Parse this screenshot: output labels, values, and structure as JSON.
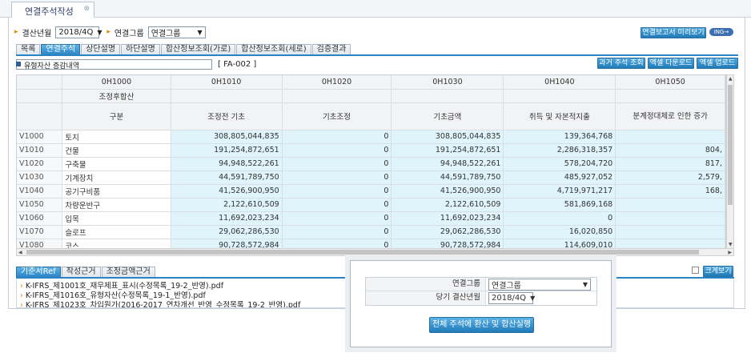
{
  "window_tab": {
    "title": "연결주석작성",
    "close": "⊗"
  },
  "filters": {
    "period_label": "결산년월",
    "period_value": "2018/4Q",
    "group_label": "연결그룹",
    "group_value": "연결그룹"
  },
  "buttons": {
    "preview": "연결보고서 미리보기",
    "ing": "ING→"
  },
  "subtabs": [
    "목록",
    "연결주석",
    "상단설명",
    "하단설명",
    "합산정보조회(가로)",
    "합산정보조회(세로)",
    "검증결과"
  ],
  "account": {
    "name": "유형자산 증감내역",
    "code": "[ FA-002 ]"
  },
  "actions": {
    "past": "과거 주석 조회",
    "download": "엑셀 다운로드",
    "upload": "엑셀 업로드"
  },
  "grid": {
    "col_codes": [
      "0H1000",
      "0H1010",
      "0H1020",
      "0H1030",
      "0H1040",
      "0H1050"
    ],
    "group_label": "조정후합산",
    "kind_label": "구분",
    "col_names": [
      "조정전 기초",
      "기초조정",
      "기초금액",
      "취득 및 자본적지출",
      "분계정대체로 인한 증가"
    ],
    "rows": [
      {
        "code": "V1000",
        "name": "토지",
        "v": [
          "308,805,044,835",
          "0",
          "308,805,044,835",
          "139,364,768",
          ""
        ]
      },
      {
        "code": "V1010",
        "name": "건물",
        "v": [
          "191,254,872,651",
          "0",
          "191,254,872,651",
          "2,286,318,357",
          "804,"
        ]
      },
      {
        "code": "V1020",
        "name": "구축물",
        "v": [
          "94,948,522,261",
          "0",
          "94,948,522,261",
          "578,204,720",
          "817,"
        ]
      },
      {
        "code": "V1030",
        "name": "기계장치",
        "v": [
          "44,591,789,750",
          "0",
          "44,591,789,750",
          "485,927,052",
          "2,579,"
        ]
      },
      {
        "code": "V1040",
        "name": "공기구비품",
        "v": [
          "41,526,900,950",
          "0",
          "41,526,900,950",
          "4,719,971,217",
          "168,"
        ]
      },
      {
        "code": "V1050",
        "name": "차량운반구",
        "v": [
          "2,122,610,509",
          "0",
          "2,122,610,509",
          "581,869,168",
          ""
        ]
      },
      {
        "code": "V1060",
        "name": "입목",
        "v": [
          "11,692,023,234",
          "0",
          "11,692,023,234",
          "0",
          ""
        ]
      },
      {
        "code": "V1070",
        "name": "슬로프",
        "v": [
          "29,062,286,530",
          "0",
          "29,062,286,530",
          "16,020,850",
          ""
        ]
      },
      {
        "code": "V1080",
        "name": "코스",
        "v": [
          "90,728,572,984",
          "0",
          "90,728,572,984",
          "114,609,010",
          ""
        ]
      }
    ]
  },
  "bottom_tabs": [
    "기준서Ref",
    "작성근거",
    "조정금액근거"
  ],
  "bottom_btn": "크게보기",
  "files": [
    "K-IFRS_제1001호_재무제표_표시(수정목록_19-2_반영).pdf",
    "K-IFRS_제1016호_유형자산(수정목록_19-1_반영).pdf",
    "K-IFRS_제1023호_차입원가(2016-2017_연차개선_반영_수정목록_19-2_반영).pdf"
  ],
  "popup": {
    "group_label": "연결그룹",
    "group_value": "연결그룹",
    "period_label": "당기 결산년월",
    "period_value": "2018/4Q",
    "run_button": "전체 주석에 환산 및 합산실행"
  }
}
